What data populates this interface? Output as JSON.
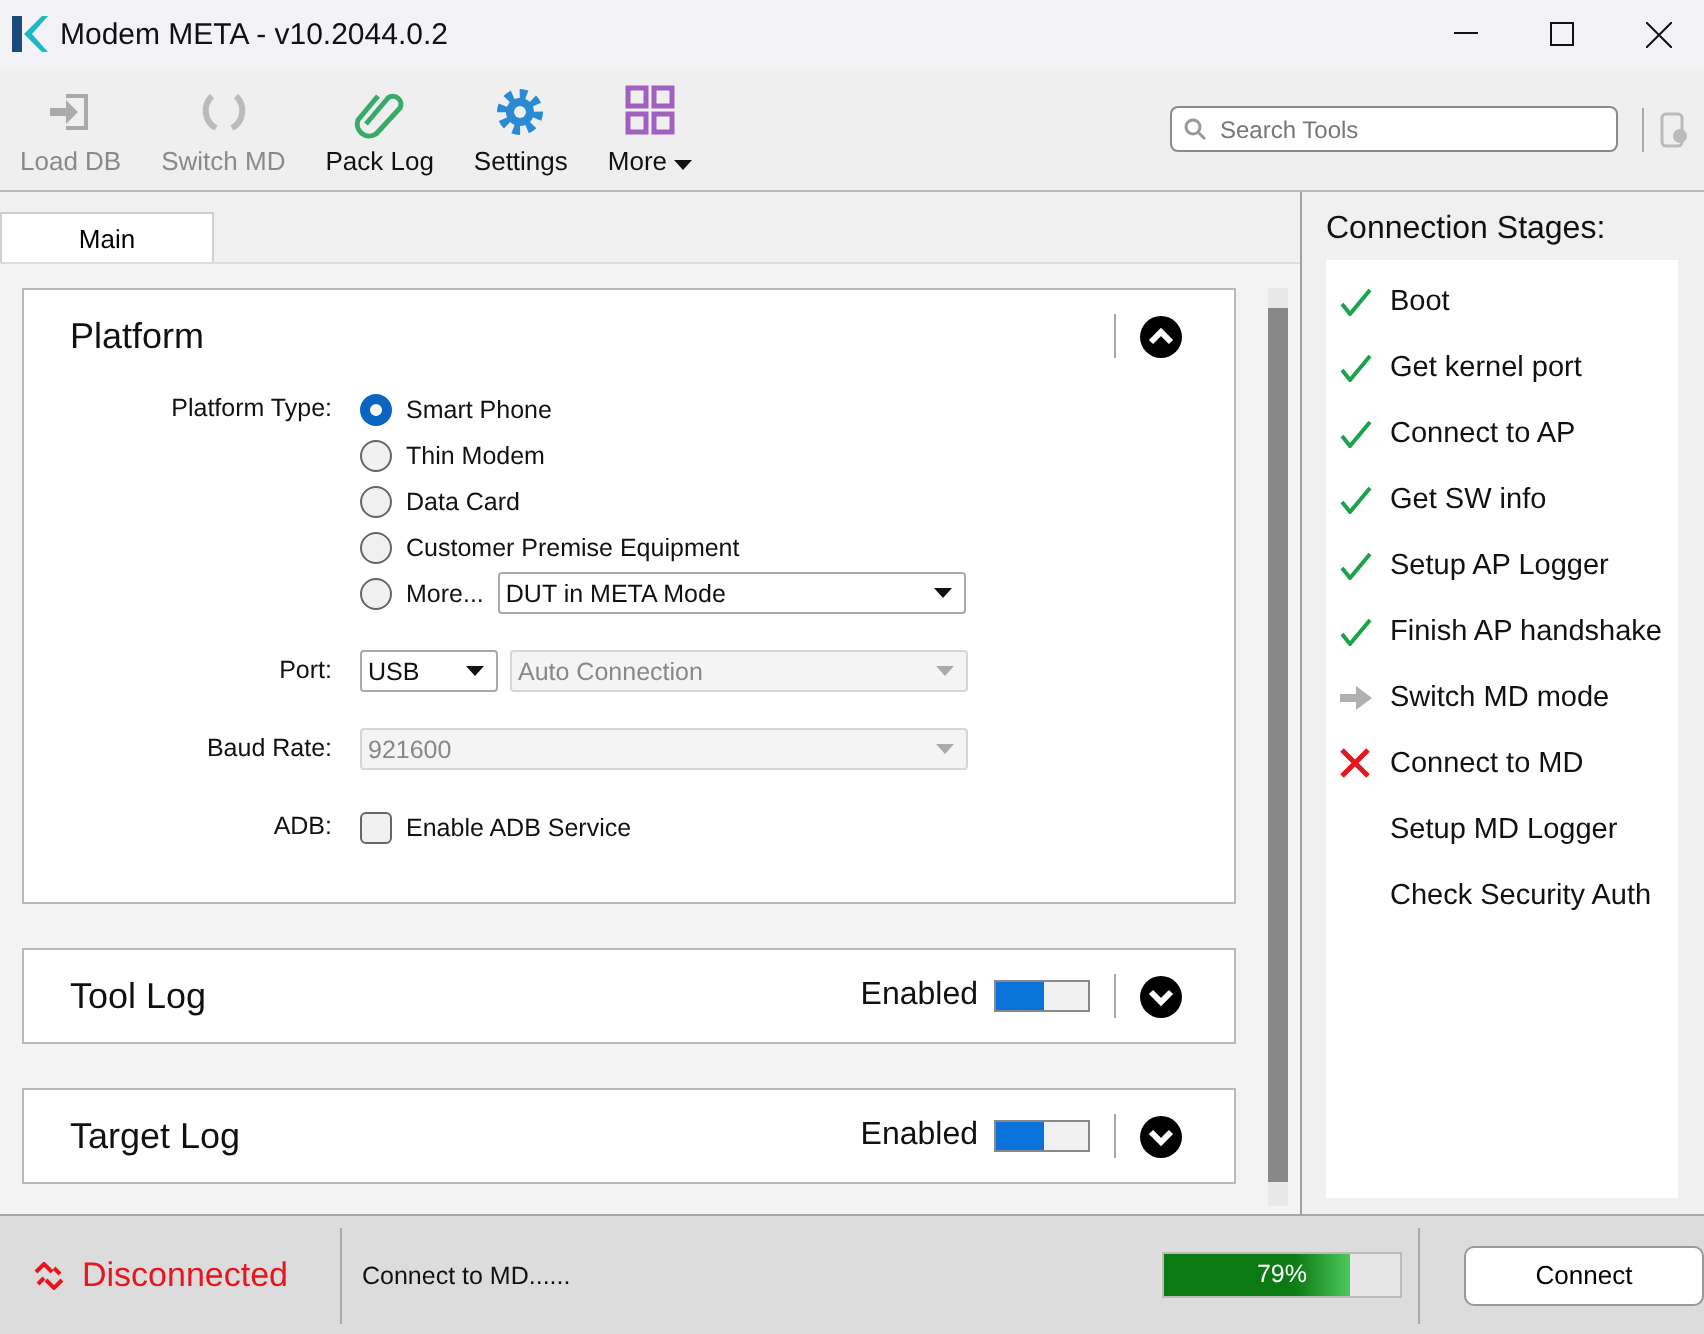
{
  "window": {
    "title": "Modem META - v10.2044.0.2"
  },
  "toolbar": {
    "buttons": [
      {
        "label": "Load DB",
        "kind": "load",
        "disabled": true
      },
      {
        "label": "Switch MD",
        "kind": "switch",
        "disabled": true
      },
      {
        "label": "Pack Log",
        "kind": "clip",
        "disabled": false
      },
      {
        "label": "Settings",
        "kind": "gear",
        "disabled": false
      },
      {
        "label": "More",
        "kind": "grid",
        "disabled": false,
        "has_menu": true
      }
    ],
    "search": {
      "placeholder": "Search Tools"
    }
  },
  "tabs": [
    {
      "label": "Main",
      "selected": true
    }
  ],
  "platform": {
    "title": "Platform",
    "expanded": true,
    "type_label": "Platform Type:",
    "options": [
      {
        "label": "Smart Phone",
        "selected": true
      },
      {
        "label": "Thin Modem",
        "selected": false
      },
      {
        "label": "Data Card",
        "selected": false
      },
      {
        "label": "Customer Premise Equipment",
        "selected": false
      },
      {
        "label": "More...",
        "selected": false,
        "dropdown": "DUT in META Mode"
      }
    ],
    "port": {
      "label": "Port:",
      "value": "USB",
      "connection": "Auto Connection",
      "connection_disabled": true
    },
    "baud": {
      "label": "Baud Rate:",
      "value": "921600",
      "disabled": true
    },
    "adb": {
      "label": "ADB:",
      "checkbox": "Enable ADB Service",
      "checked": false
    }
  },
  "logs": [
    {
      "title": "Tool Log",
      "status": "Enabled",
      "on": true,
      "expanded": false
    },
    {
      "title": "Target Log",
      "status": "Enabled",
      "on": true,
      "expanded": false
    }
  ],
  "stages": {
    "title": "Connection Stages:",
    "items": [
      {
        "label": "Boot",
        "kind": "done"
      },
      {
        "label": "Get kernel port",
        "kind": "done"
      },
      {
        "label": "Connect to AP",
        "kind": "done"
      },
      {
        "label": "Get SW info",
        "kind": "done"
      },
      {
        "label": "Setup AP Logger",
        "kind": "done"
      },
      {
        "label": "Finish AP handshake",
        "kind": "done"
      },
      {
        "label": "Switch MD mode",
        "kind": "current"
      },
      {
        "label": "Connect to MD",
        "kind": "failed"
      },
      {
        "label": "Setup MD Logger",
        "kind": "pending"
      },
      {
        "label": "Check Security Auth",
        "kind": "pending"
      }
    ]
  },
  "status_bar": {
    "connection": "Disconnected",
    "message": "Connect to MD......",
    "progress": {
      "level": 0.79,
      "reading": "79%"
    },
    "button": "Connect"
  }
}
